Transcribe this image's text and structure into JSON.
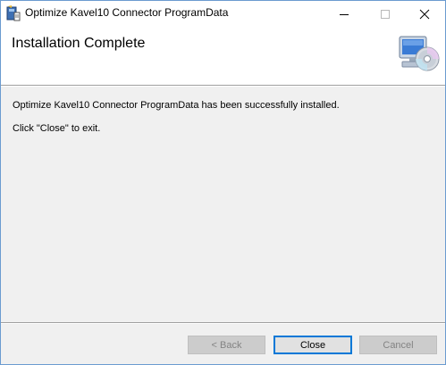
{
  "window": {
    "title": "Optimize Kavel10 Connector ProgramData",
    "controls": {
      "minimize": "minimize",
      "maximize": "maximize",
      "close": "close"
    }
  },
  "banner": {
    "heading": "Installation Complete",
    "icon": "computer-cd-icon"
  },
  "content": {
    "message": "Optimize Kavel10 Connector ProgramData has been successfully installed.",
    "instruction": "Click \"Close\" to exit."
  },
  "buttons": {
    "back_label": "< Back",
    "close_label": "Close",
    "cancel_label": "Cancel"
  },
  "colors": {
    "accent": "#0078d7",
    "window_bg": "#f0f0f0",
    "banner_bg": "#ffffff"
  }
}
